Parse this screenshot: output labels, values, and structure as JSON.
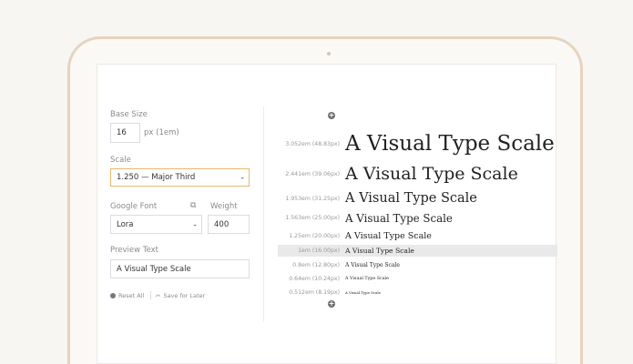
{
  "left_panel": {
    "base_size": {
      "label": "Base Size",
      "value": "16",
      "unit": "px (1em)"
    },
    "scale": {
      "label": "Scale",
      "selected": "1.250 — Major Third"
    },
    "google_font": {
      "label": "Google Font",
      "selected": "Lora"
    },
    "weight": {
      "label": "Weight",
      "value": "400"
    },
    "preview_text": {
      "label": "Preview Text",
      "value": "A Visual Type Scale"
    },
    "reset_label": "Reset All",
    "save_label": "Save for Later"
  },
  "scale_rows": [
    {
      "em": "3.052em (48.83px)",
      "sample": "A Visual Type Scale",
      "highlighted": false
    },
    {
      "em": "2.441em (39.06px)",
      "sample": "A Visual Type Scale",
      "highlighted": false
    },
    {
      "em": "1.953em (31.25px)",
      "sample": "A Visual Type Scale",
      "highlighted": false
    },
    {
      "em": "1.563em (25.00px)",
      "sample": "A Visual Type Scale",
      "highlighted": false
    },
    {
      "em": "1.25em (20.00px)",
      "sample": "A Visual Type Scale",
      "highlighted": false
    },
    {
      "em": "1em (16.00px)",
      "sample": "A Visual Type Scale",
      "highlighted": true
    },
    {
      "em": "0.8em (12.80px)",
      "sample": "A Visual Type Scale",
      "highlighted": false
    },
    {
      "em": "0.64em (10.24px)",
      "sample": "A Visual Type Scale",
      "highlighted": false
    },
    {
      "em": "0.512em (8.19px)",
      "sample": "A Visual Type Scale",
      "highlighted": false
    }
  ],
  "icons": {
    "add_top": "plus-circle-icon",
    "add_bottom": "plus-circle-icon",
    "external_link": "external-link-icon",
    "reset": "reset-icon",
    "save": "bookmark-icon",
    "dropdown": "chevron-down-icon"
  },
  "colors": {
    "focus_border": "#e7b96b",
    "laptop_bezel": "#e6d3c0",
    "highlight_row": "#e9e9e9"
  }
}
